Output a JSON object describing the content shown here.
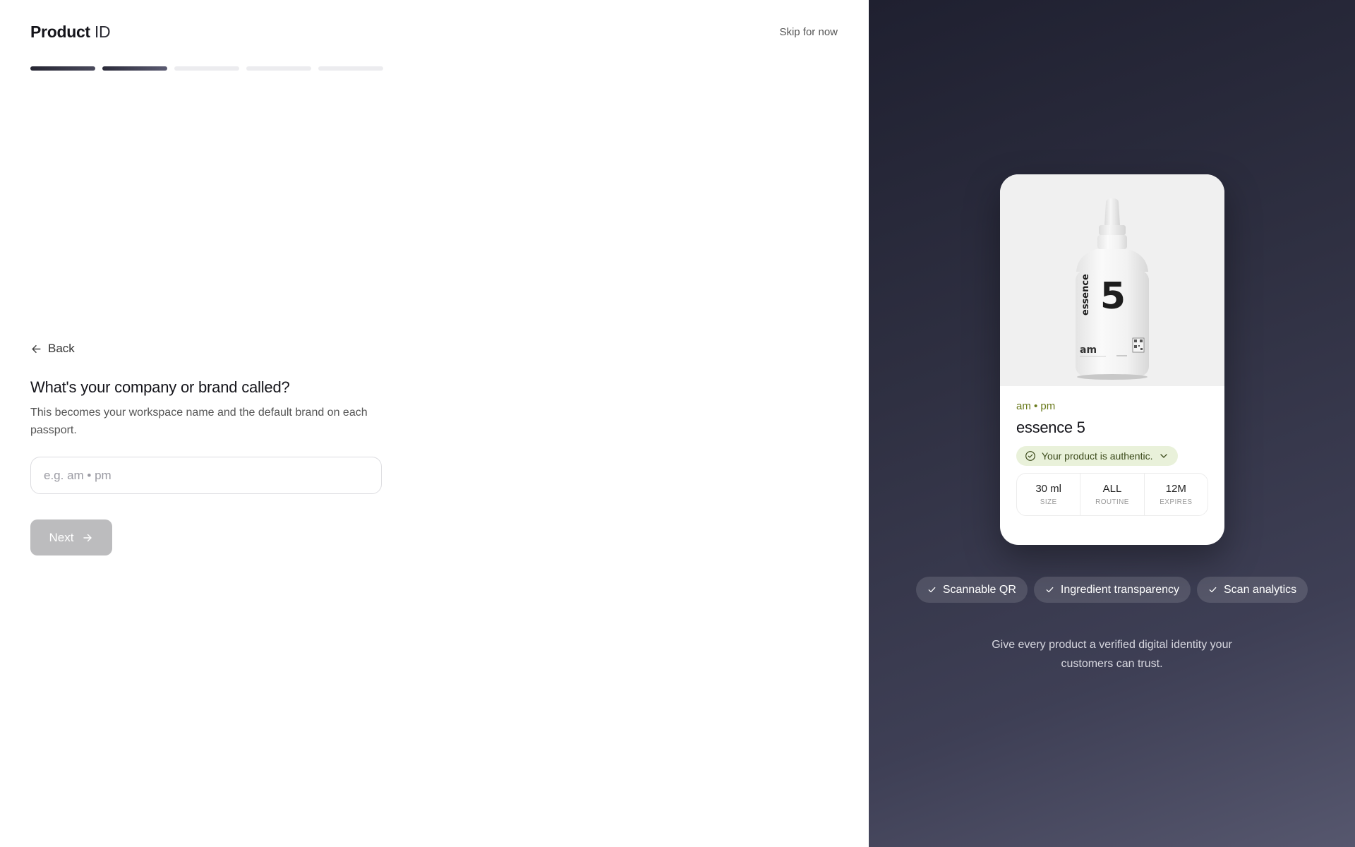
{
  "header": {
    "logo_bold": "Product",
    "logo_light": "ID",
    "skip_label": "Skip for now"
  },
  "progress": {
    "total_steps": 5,
    "completed_steps": 2
  },
  "form": {
    "back_label": "Back",
    "question": "What's your company or brand called?",
    "subtitle": "This becomes your workspace name and the default brand on each passport.",
    "input_value": "",
    "input_placeholder": "e.g. am • pm",
    "next_label": "Next"
  },
  "preview": {
    "bottle": {
      "number": "5",
      "name_text": "essence",
      "brand_mark": "am"
    },
    "brand": "am • pm",
    "product_name": "essence 5",
    "auth_badge": "Your product is authentic.",
    "stats": [
      {
        "value": "30 ml",
        "label": "SIZE"
      },
      {
        "value": "ALL",
        "label": "ROUTINE"
      },
      {
        "value": "12M",
        "label": "EXPIRES"
      }
    ]
  },
  "features": [
    "Scannable QR",
    "Ingredient transparency",
    "Scan analytics"
  ],
  "tagline": {
    "line1": "Give every product a verified digital identity your",
    "line2": "customers can trust."
  },
  "colors": {
    "accent": "#2a2a38",
    "brand_green": "#6a7a1c",
    "auth_bg": "#e9f1da",
    "disabled_button": "#bcbcbe"
  }
}
